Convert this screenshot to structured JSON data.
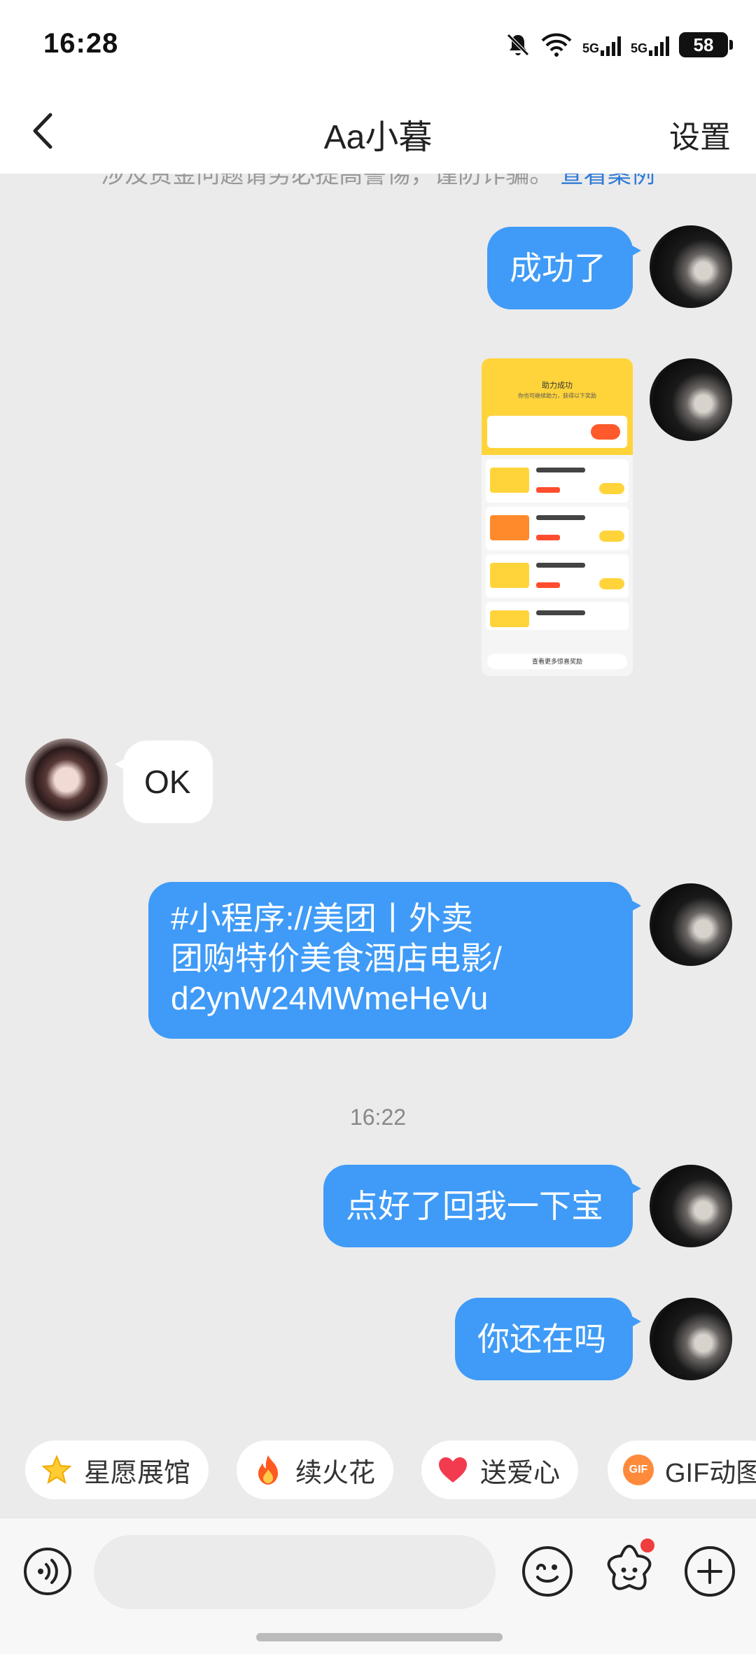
{
  "status": {
    "time": "16:28",
    "battery": "58",
    "sim1": "5G",
    "sim2": "5G"
  },
  "header": {
    "title": "Aa小暮",
    "settings_label": "设置",
    "back_icon": "chevron-left-icon"
  },
  "notice": {
    "text": "涉及资金问题请务必提高警惕，谨防诈骗。",
    "link": "查看案例"
  },
  "messages": [
    {
      "side": "out",
      "type": "text",
      "text": "成功了"
    },
    {
      "side": "out",
      "type": "image",
      "alt": "screenshot",
      "labels": {
        "title": "助力成功",
        "sub": "你也可继续助力，获得以下奖励",
        "more": "查看更多惊喜奖励"
      }
    },
    {
      "side": "in",
      "type": "text",
      "text": "OK"
    },
    {
      "side": "out",
      "type": "text",
      "lines": [
        "#小程序://美团丨外卖",
        "团购特价美食酒店电影/",
        "d2ynW24MWmeHeVu"
      ]
    },
    {
      "type": "time",
      "text": "16:22"
    },
    {
      "side": "out",
      "type": "text",
      "text": "点好了回我一下宝"
    },
    {
      "side": "out",
      "type": "text",
      "text": "你还在吗"
    }
  ],
  "chips": [
    {
      "label": "星愿展馆",
      "icon": "star-icon"
    },
    {
      "label": "续火花",
      "icon": "fire-icon"
    },
    {
      "label": "送爱心",
      "icon": "heart-icon"
    },
    {
      "label": "GIF动图",
      "icon": "gif-icon"
    }
  ],
  "input": {
    "placeholder": ""
  },
  "colors": {
    "bubble_out": "#3f9bf7",
    "bubble_in": "#ffffff",
    "background": "#ebebeb",
    "link": "#2f7ad6",
    "badge": "#f03e3e"
  }
}
